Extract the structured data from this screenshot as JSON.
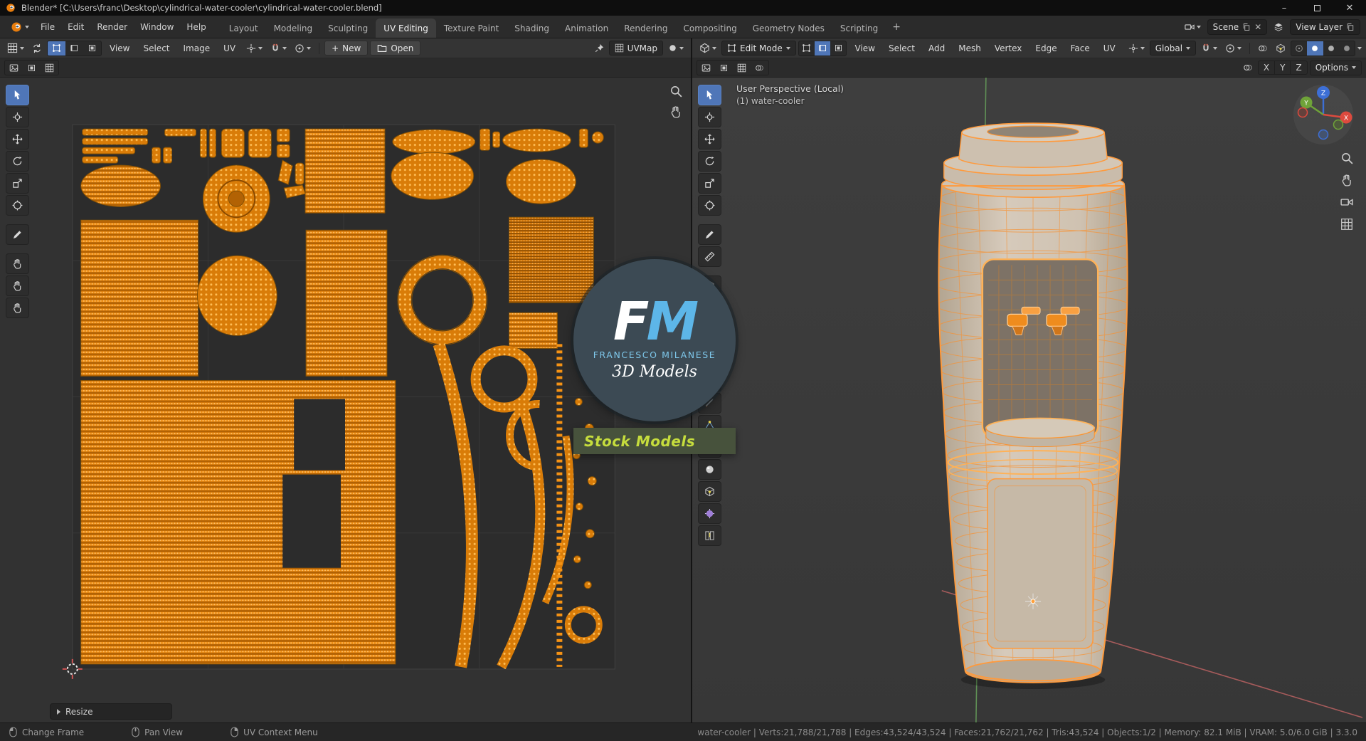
{
  "window": {
    "title": "Blender* [C:\\Users\\franc\\Desktop\\cylindrical-water-cooler\\cylindrical-water-cooler.blend]"
  },
  "topbar": {
    "menus": [
      "File",
      "Edit",
      "Render",
      "Window",
      "Help"
    ],
    "workspaces": [
      "Layout",
      "Modeling",
      "Sculpting",
      "UV Editing",
      "Texture Paint",
      "Shading",
      "Animation",
      "Rendering",
      "Compositing",
      "Geometry Nodes",
      "Scripting"
    ],
    "active_workspace": "UV Editing",
    "add_workspace": "+",
    "scene": "Scene",
    "view_layer": "View Layer"
  },
  "uv_editor": {
    "menus": [
      "View",
      "Select",
      "Image",
      "UV"
    ],
    "new_button": "New",
    "open_button": "Open",
    "uv_map": "UVMap",
    "resize_panel": "Resize"
  },
  "viewport": {
    "mode": "Edit Mode",
    "menus": [
      "View",
      "Select",
      "Add",
      "Mesh",
      "Vertex",
      "Edge",
      "Face",
      "UV"
    ],
    "orientation": "Global",
    "options": "Options",
    "mirror": {
      "x": "X",
      "y": "Y",
      "z": "Z"
    },
    "overlay": {
      "line1": "User Perspective (Local)",
      "line2": "(1) water-cooler"
    },
    "gizmo": {
      "x": "X",
      "y": "Y",
      "z": "Z"
    }
  },
  "status_bar": {
    "hints": [
      {
        "button": "left",
        "label": "Change Frame"
      },
      {
        "button": "middle",
        "label": "Pan View"
      },
      {
        "button": "right",
        "label": "UV Context Menu"
      }
    ],
    "stats": "water-cooler | Verts:21,788/21,788 | Edges:43,524/43,524 | Faces:21,762/21,762 | Tris:43,524 | Objects:1/2 | Memory: 82.1 MiB | VRAM: 5.0/6.0 GiB | 3.3.0"
  },
  "watermark": {
    "initial_f": "F",
    "initial_m": "M",
    "name": "FRANCESCO MILANESE",
    "tagline": "3D Models",
    "banner": "Stock Models"
  },
  "colors": {
    "uv_orange": "#f08c12",
    "selection_orange": "#ff9a3c",
    "active_tool_blue": "#4f76b8",
    "axis_x": "#dd4a3e",
    "axis_y": "#6fa339",
    "axis_z": "#3d6fd6",
    "watermark_blue": "#5db6e8",
    "watermark_green": "#c6dd3d"
  }
}
